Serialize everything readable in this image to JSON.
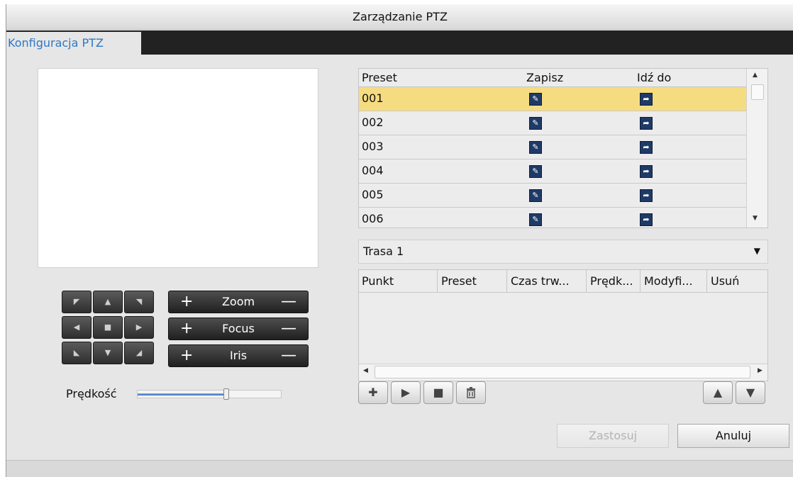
{
  "window": {
    "title": "Zarządzanie PTZ"
  },
  "tabs": [
    {
      "label": "Konfiguracja PTZ",
      "active": true
    }
  ],
  "ptz_controls": {
    "directions": [
      "up-left-icon",
      "up-icon",
      "up-right-icon",
      "left-icon",
      "stop-icon",
      "right-icon",
      "down-left-icon",
      "down-icon",
      "down-right-icon"
    ],
    "zoom": {
      "label": "Zoom",
      "plus": "+",
      "minus": "—"
    },
    "focus": {
      "label": "Focus",
      "plus": "+",
      "minus": "—"
    },
    "iris": {
      "label": "Iris",
      "plus": "+",
      "minus": "—"
    },
    "speed": {
      "label": "Prędkość",
      "value": 0.62
    }
  },
  "preset_table": {
    "headers": {
      "preset": "Preset",
      "save": "Zapisz",
      "goto": "Idź do"
    },
    "rows": [
      {
        "preset": "001",
        "selected": true
      },
      {
        "preset": "002",
        "selected": false
      },
      {
        "preset": "003",
        "selected": false
      },
      {
        "preset": "004",
        "selected": false
      },
      {
        "preset": "005",
        "selected": false
      },
      {
        "preset": "006",
        "selected": false
      }
    ]
  },
  "route": {
    "selected": "Trasa 1",
    "headers": {
      "point": "Punkt",
      "preset": "Preset",
      "duration": "Czas trw...",
      "speed": "Prędk...",
      "modify": "Modyfi...",
      "delete": "Usuń"
    },
    "rows": []
  },
  "toolbar": {
    "icons": [
      "add-icon",
      "play-icon",
      "stop-icon",
      "delete-icon",
      "move-up-icon",
      "move-down-icon"
    ]
  },
  "buttons": {
    "apply": "Zastosuj",
    "cancel": "Anuluj"
  },
  "colors": {
    "accent": "#2e78c4",
    "selection": "#f6dc80",
    "tab_bar": "#222222"
  }
}
